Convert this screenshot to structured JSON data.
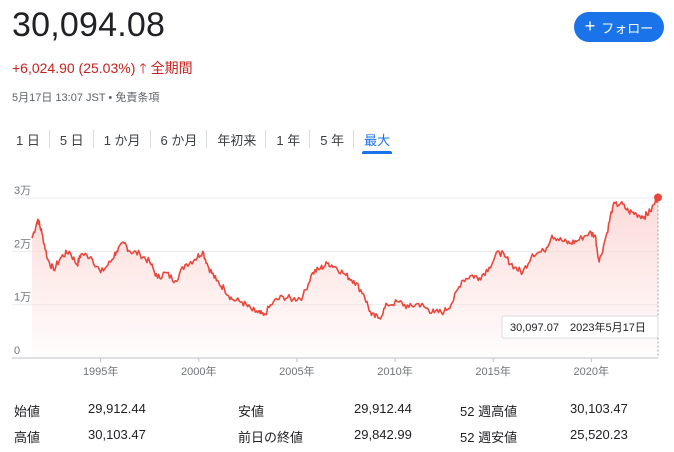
{
  "quote": {
    "price": "30,094.08",
    "change": "+6,024.90 (25.03%)",
    "change_arrow": "🡑",
    "period": "全期間",
    "meta": "5月17日 13:07 JST • 免責条項"
  },
  "follow_button": {
    "icon": "plus-icon",
    "label": "フォロー"
  },
  "tabs": [
    {
      "label": "1 日"
    },
    {
      "label": "5 日"
    },
    {
      "label": "1 か月"
    },
    {
      "label": "6 か月"
    },
    {
      "label": "年初来"
    },
    {
      "label": "1 年"
    },
    {
      "label": "5 年"
    },
    {
      "label": "最大",
      "active": true
    }
  ],
  "colors": {
    "accent": "#1a73e8",
    "down_red": "#c5221f",
    "line": "#e9473c",
    "fill_top": "#fbd5d2"
  },
  "chart_data": {
    "type": "line",
    "y_ticks": [
      {
        "value": 0,
        "label": "0"
      },
      {
        "value": 10000,
        "label": "1万"
      },
      {
        "value": 20000,
        "label": "2万"
      },
      {
        "value": 30000,
        "label": "3万"
      }
    ],
    "x_ticks": [
      {
        "value": 1995,
        "label": "1995年"
      },
      {
        "value": 2000,
        "label": "2000年"
      },
      {
        "value": 2005,
        "label": "2005年"
      },
      {
        "value": 2010,
        "label": "2010年"
      },
      {
        "value": 2015,
        "label": "2015年"
      },
      {
        "value": 2020,
        "label": "2020年"
      }
    ],
    "xlim": [
      1991.5,
      2023.4
    ],
    "ylim": [
      0,
      30000
    ],
    "grid": true,
    "x": [
      1991.5,
      1991.8,
      1992.0,
      1992.3,
      1992.6,
      1993.0,
      1993.4,
      1993.8,
      1994.0,
      1994.5,
      1995.0,
      1995.5,
      1995.8,
      1996.2,
      1996.5,
      1997.0,
      1997.5,
      1997.9,
      1998.3,
      1998.8,
      1999.3,
      1999.8,
      2000.2,
      2000.5,
      2000.9,
      2001.3,
      2001.7,
      2002.2,
      2002.7,
      2003.0,
      2003.3,
      2003.8,
      2004.3,
      2004.8,
      2005.3,
      2005.8,
      2006.2,
      2006.6,
      2007.0,
      2007.5,
      2007.9,
      2008.4,
      2008.8,
      2009.2,
      2009.6,
      2010.2,
      2010.7,
      2011.2,
      2011.6,
      2012.0,
      2012.5,
      2012.9,
      2013.4,
      2013.9,
      2014.3,
      2014.8,
      2015.3,
      2015.6,
      2016.1,
      2016.5,
      2017.0,
      2017.6,
      2018.0,
      2018.5,
      2018.9,
      2019.3,
      2019.9,
      2020.2,
      2020.4,
      2020.8,
      2021.1,
      2021.5,
      2021.9,
      2022.3,
      2022.7,
      2023.0,
      2023.4
    ],
    "y": [
      22500,
      26000,
      23500,
      18500,
      16500,
      19000,
      20000,
      17500,
      19500,
      19000,
      16000,
      18000,
      20000,
      21500,
      20000,
      19500,
      18000,
      15000,
      16000,
      14500,
      17500,
      18500,
      20000,
      17000,
      14500,
      13000,
      11000,
      10500,
      9000,
      8500,
      8000,
      10500,
      11500,
      11000,
      11500,
      16000,
      16800,
      17800,
      17000,
      15500,
      14500,
      12000,
      8000,
      7500,
      10000,
      10500,
      9500,
      10200,
      9300,
      8500,
      8700,
      10300,
      14500,
      15500,
      15000,
      17000,
      20000,
      19000,
      17000,
      16000,
      19500,
      20000,
      23000,
      22000,
      21500,
      22000,
      23500,
      23000,
      18000,
      23500,
      28500,
      29000,
      27500,
      27000,
      26500,
      27500,
      30100
    ],
    "end_marker": {
      "x": 2023.4,
      "y": 30094
    },
    "hover_value": "30,097.07",
    "hover_date": "2023年5月17日"
  },
  "stats": {
    "col1": [
      {
        "label": "始値",
        "value": "29,912.44"
      },
      {
        "label": "高値",
        "value": "30,103.47"
      }
    ],
    "col2": [
      {
        "label": "安値",
        "value": "29,912.44"
      },
      {
        "label": "前日の終値",
        "value": "29,842.99"
      }
    ],
    "col3": [
      {
        "label": "52 週高値",
        "value": "30,103.47"
      },
      {
        "label": "52 週安値",
        "value": "25,520.23"
      }
    ]
  }
}
